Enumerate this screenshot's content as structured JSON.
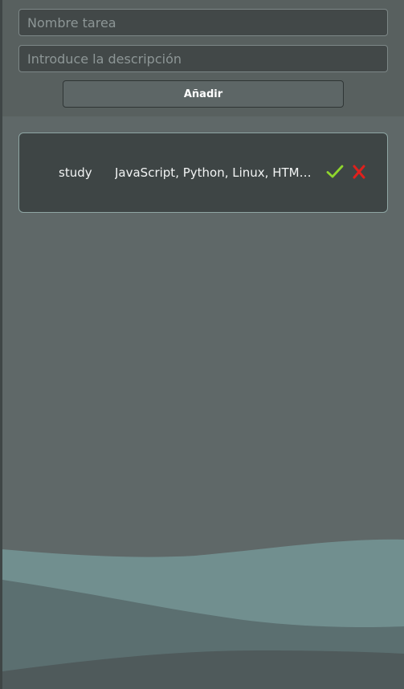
{
  "form": {
    "name_placeholder": "Nombre tarea",
    "description_placeholder": "Introduce la descripción",
    "add_label": "Añadir"
  },
  "tasks": [
    {
      "name": "study",
      "description": "JavaScript, Python, Linux, HTML, CSS"
    }
  ],
  "icons": {
    "complete": "check-icon",
    "delete": "close-icon"
  },
  "colors": {
    "check": "#8fd62d",
    "delete": "#e0201c",
    "background": "#5f6868",
    "card": "#3e4545",
    "wave_light": "#718f8f",
    "wave_mid": "#5b6f70",
    "wave_dark": "#4f5a5b"
  }
}
